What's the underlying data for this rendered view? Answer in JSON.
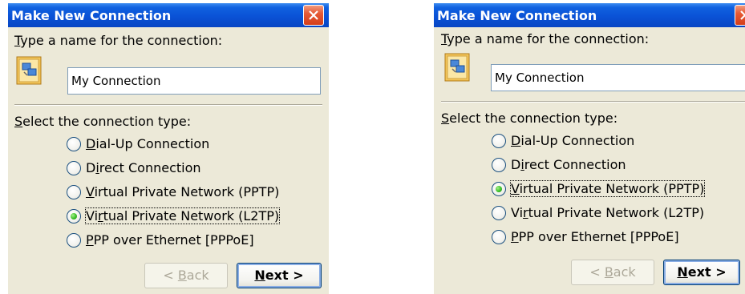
{
  "dialogs": [
    {
      "title": "Make New Connection",
      "name_prompt_key": "T",
      "name_prompt_rest": "ype a name for the connection:",
      "connection_name": "My Connection",
      "type_prompt_key": "S",
      "type_prompt_rest": "elect the connection type:",
      "options": [
        {
          "pre": "",
          "key": "D",
          "post": "ial-Up Connection",
          "selected": false
        },
        {
          "pre": "D",
          "key": "i",
          "post": "rect Connection",
          "selected": false
        },
        {
          "pre": "",
          "key": "V",
          "post": "irtual Private Network (PPTP)",
          "selected": false
        },
        {
          "pre": "Vi",
          "key": "r",
          "post": "tual Private Network (L2TP)",
          "selected": true
        },
        {
          "pre": "",
          "key": "P",
          "post": "PP over Ethernet [PPPoE]",
          "selected": false
        }
      ],
      "back_label_pre": "< ",
      "back_label_key": "B",
      "back_label_post": "ack",
      "next_label_key": "N",
      "next_label_post": "ext >"
    },
    {
      "title": "Make New Connection",
      "name_prompt_key": "T",
      "name_prompt_rest": "ype a name for the connection:",
      "connection_name": "My Connection",
      "type_prompt_key": "S",
      "type_prompt_rest": "elect the connection type:",
      "options": [
        {
          "pre": "",
          "key": "D",
          "post": "ial-Up Connection",
          "selected": false
        },
        {
          "pre": "D",
          "key": "i",
          "post": "rect Connection",
          "selected": false
        },
        {
          "pre": "",
          "key": "V",
          "post": "irtual Private Network (PPTP)",
          "selected": true
        },
        {
          "pre": "Vi",
          "key": "r",
          "post": "tual Private Network (L2TP)",
          "selected": false
        },
        {
          "pre": "",
          "key": "P",
          "post": "PP over Ethernet [PPPoE]",
          "selected": false
        }
      ],
      "back_label_pre": "< ",
      "back_label_key": "B",
      "back_label_post": "ack",
      "next_label_key": "N",
      "next_label_post": "ext >"
    }
  ],
  "icons": {
    "close": "close-icon",
    "connection": "network-connection-icon"
  },
  "colors": {
    "titlebar": "#0a52d6",
    "close_button": "#e65a36",
    "dialog_bg": "#ece9d8",
    "radio_selected": "#3cc02a"
  }
}
